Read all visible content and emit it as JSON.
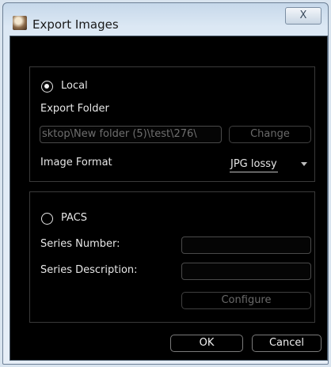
{
  "window": {
    "title": "Export Images",
    "close_glyph": "X",
    "icon": "app-icon"
  },
  "local": {
    "radio_label": "Local",
    "selected": true,
    "export_folder_label": "Export Folder",
    "export_folder_value": "sktop\\New folder (5)\\test\\276\\",
    "change_label": "Change",
    "image_format_label": "Image Format",
    "image_format_value": "JPG lossy"
  },
  "pacs": {
    "radio_label": "PACS",
    "selected": false,
    "series_number_label": "Series Number:",
    "series_number_value": "",
    "series_description_label": "Series Description:",
    "series_description_value": "",
    "configure_label": "Configure"
  },
  "footer": {
    "ok_label": "OK",
    "cancel_label": "Cancel"
  }
}
